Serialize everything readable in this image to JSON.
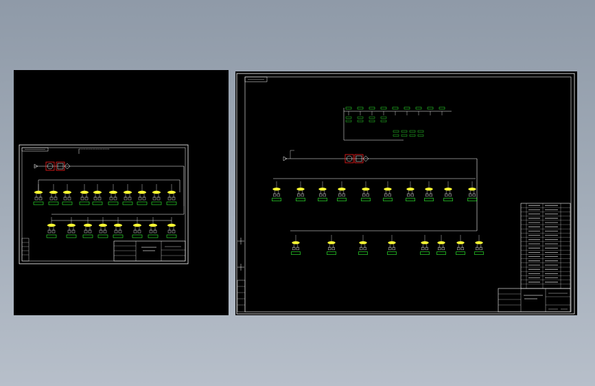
{
  "colors": {
    "background_top": "#8f9aa8",
    "background_bottom": "#b7bfca",
    "sheet": "#000000",
    "frame": "#ffffff",
    "bus_line": "#ffffff",
    "filter_group_box": "#ff2020",
    "yellow_component": "#ffff33",
    "green_tag": "#33ff33",
    "dim_text": "#bfbfbf"
  },
  "drawings": [
    {
      "name": "left-schematic-sheet",
      "title_block_present": true
    },
    {
      "name": "right-schematic-sheet",
      "title_block_present": true,
      "parts_list_present": true
    }
  ]
}
